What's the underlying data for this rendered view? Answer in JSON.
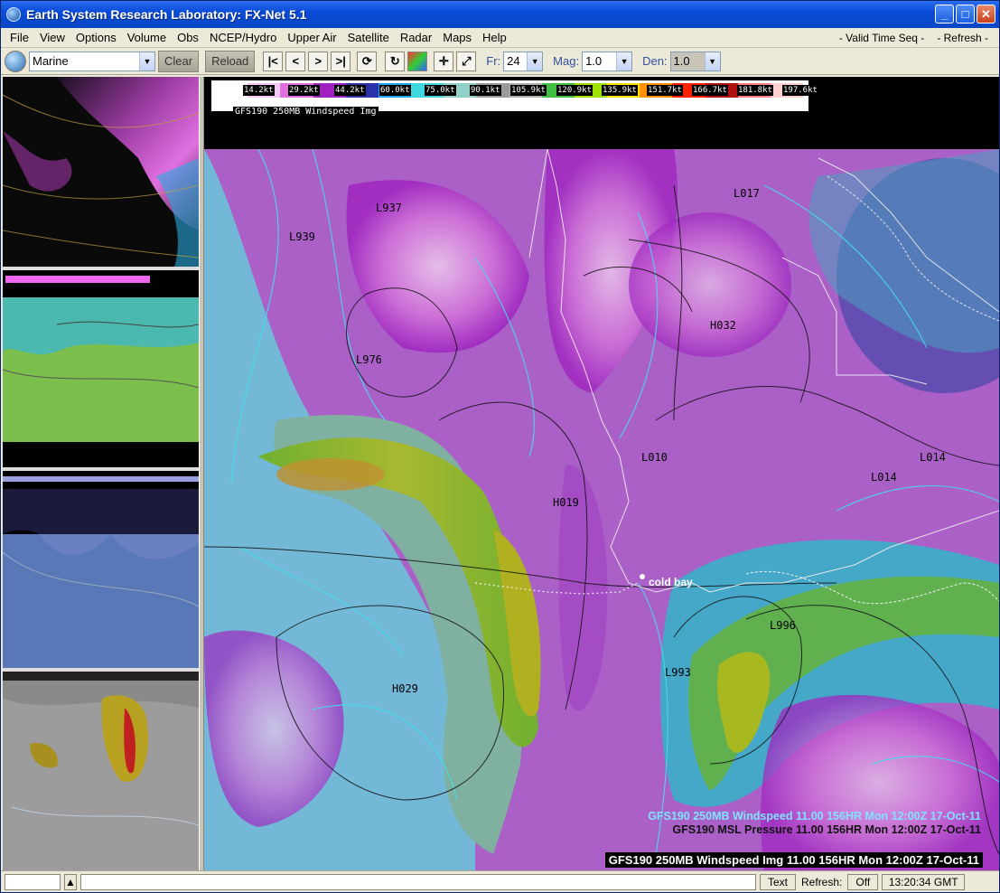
{
  "window": {
    "title": "Earth System Research Laboratory: FX-Net 5.1"
  },
  "menu": {
    "items": [
      "File",
      "View",
      "Options",
      "Volume",
      "Obs",
      "NCEP/Hydro",
      "Upper Air",
      "Satellite",
      "Radar",
      "Maps",
      "Help"
    ],
    "valid_time_seq": "- Valid Time Seq -",
    "refresh": "- Refresh -"
  },
  "toolbar": {
    "region": "Marine",
    "clear": "Clear",
    "reload": "Reload",
    "frame_label": "Fr:",
    "frame_value": "24",
    "mag_label": "Mag:",
    "mag_value": "1.0",
    "den_label": "Den:",
    "den_value": "1.0"
  },
  "legend": {
    "ticks": [
      "14.2kt",
      "29.2kt",
      "44.2kt",
      "60.0kt",
      "75.0kt",
      "90.1kt",
      "105.9kt",
      "120.9kt",
      "135.9kt",
      "151.7kt",
      "166.7kt",
      "181.8kt",
      "197.6kt"
    ],
    "colors": [
      "#ffffff",
      "#f5c8f5",
      "#e070e0",
      "#a020c0",
      "#2a30a8",
      "#18a8f0",
      "#40d8e0",
      "#8fd0c8",
      "#9a9a9a",
      "#b0b0b0",
      "#40c040",
      "#a0e000",
      "#ffe000",
      "#ff9000",
      "#ff2000",
      "#b01010",
      "#ff8080",
      "#ffd0d0"
    ],
    "caption": "GFS190 250MB Windspeed Img"
  },
  "map": {
    "station": "cold bay",
    "centers": [
      {
        "sym": "L",
        "val": "937"
      },
      {
        "sym": "L",
        "val": "939"
      },
      {
        "sym": "L",
        "val": "017"
      },
      {
        "sym": "H",
        "val": "032"
      },
      {
        "sym": "L",
        "val": "976"
      },
      {
        "sym": "L",
        "val": "010"
      },
      {
        "sym": "H",
        "val": "019"
      },
      {
        "sym": "L",
        "val": "014"
      },
      {
        "sym": "L",
        "val": "996"
      },
      {
        "sym": "L",
        "val": "993"
      },
      {
        "sym": "H",
        "val": "029"
      },
      {
        "sym": "L",
        "val": "014"
      }
    ],
    "captions": [
      "GFS190 250MB Windspeed  11.00 156HR Mon 12:00Z 17-Oct-11",
      "GFS190 MSL Pressure  11.00 156HR Mon 12:00Z 17-Oct-11",
      "GFS190 250MB Windspeed Img 11.00 156HR Mon 12:00Z 17-Oct-11"
    ]
  },
  "status": {
    "text_button": "Text",
    "refresh_label": "Refresh:",
    "refresh_value": "Off",
    "clock": "13:20:34 GMT"
  }
}
